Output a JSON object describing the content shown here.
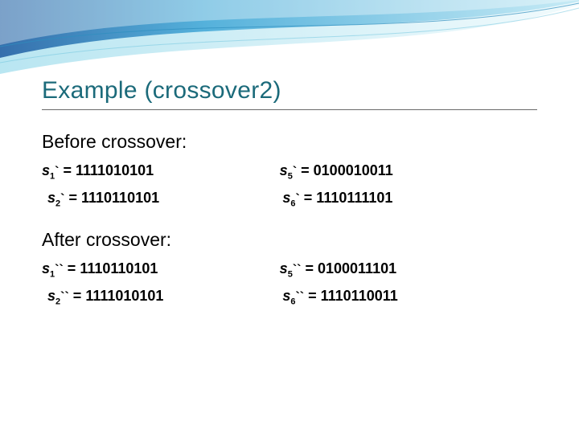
{
  "title": "Example (crossover2)",
  "before": {
    "heading": "Before crossover:",
    "rows": [
      {
        "left": {
          "var": "s",
          "sub": "1",
          "tick": "`",
          "value": "1111010101"
        },
        "right": {
          "var": "s",
          "sub": "5",
          "tick": "`",
          "value": "0100010011"
        }
      },
      {
        "left": {
          "var": "s",
          "sub": "2",
          "tick": "`",
          "value": "1110110101"
        },
        "right": {
          "var": "s",
          "sub": "6",
          "tick": "`",
          "value": "1110111101"
        }
      }
    ]
  },
  "after": {
    "heading": "After crossover:",
    "rows": [
      {
        "left": {
          "var": "s",
          "sub": "1",
          "tick": "``",
          "value": "1110110101"
        },
        "right": {
          "var": "s",
          "sub": "5",
          "tick": "``",
          "value": "0100011101"
        }
      },
      {
        "left": {
          "var": "s",
          "sub": "2",
          "tick": "``",
          "value": "1111010101"
        },
        "right": {
          "var": "s",
          "sub": "6",
          "tick": "``",
          "value": "1110110011"
        }
      }
    ]
  },
  "chart_data": {
    "type": "table",
    "title": "Example (crossover2)",
    "sections": [
      {
        "heading": "Before crossover:",
        "rows": [
          {
            "s1`": "1111010101",
            "s5`": "0100010011"
          },
          {
            "s2`": "1110110101",
            "s6`": "1110111101"
          }
        ]
      },
      {
        "heading": "After crossover:",
        "rows": [
          {
            "s1``": "1110110101",
            "s5``": "0100011101"
          },
          {
            "s2``": "1111010101",
            "s6``": "1110110011"
          }
        ]
      }
    ]
  }
}
